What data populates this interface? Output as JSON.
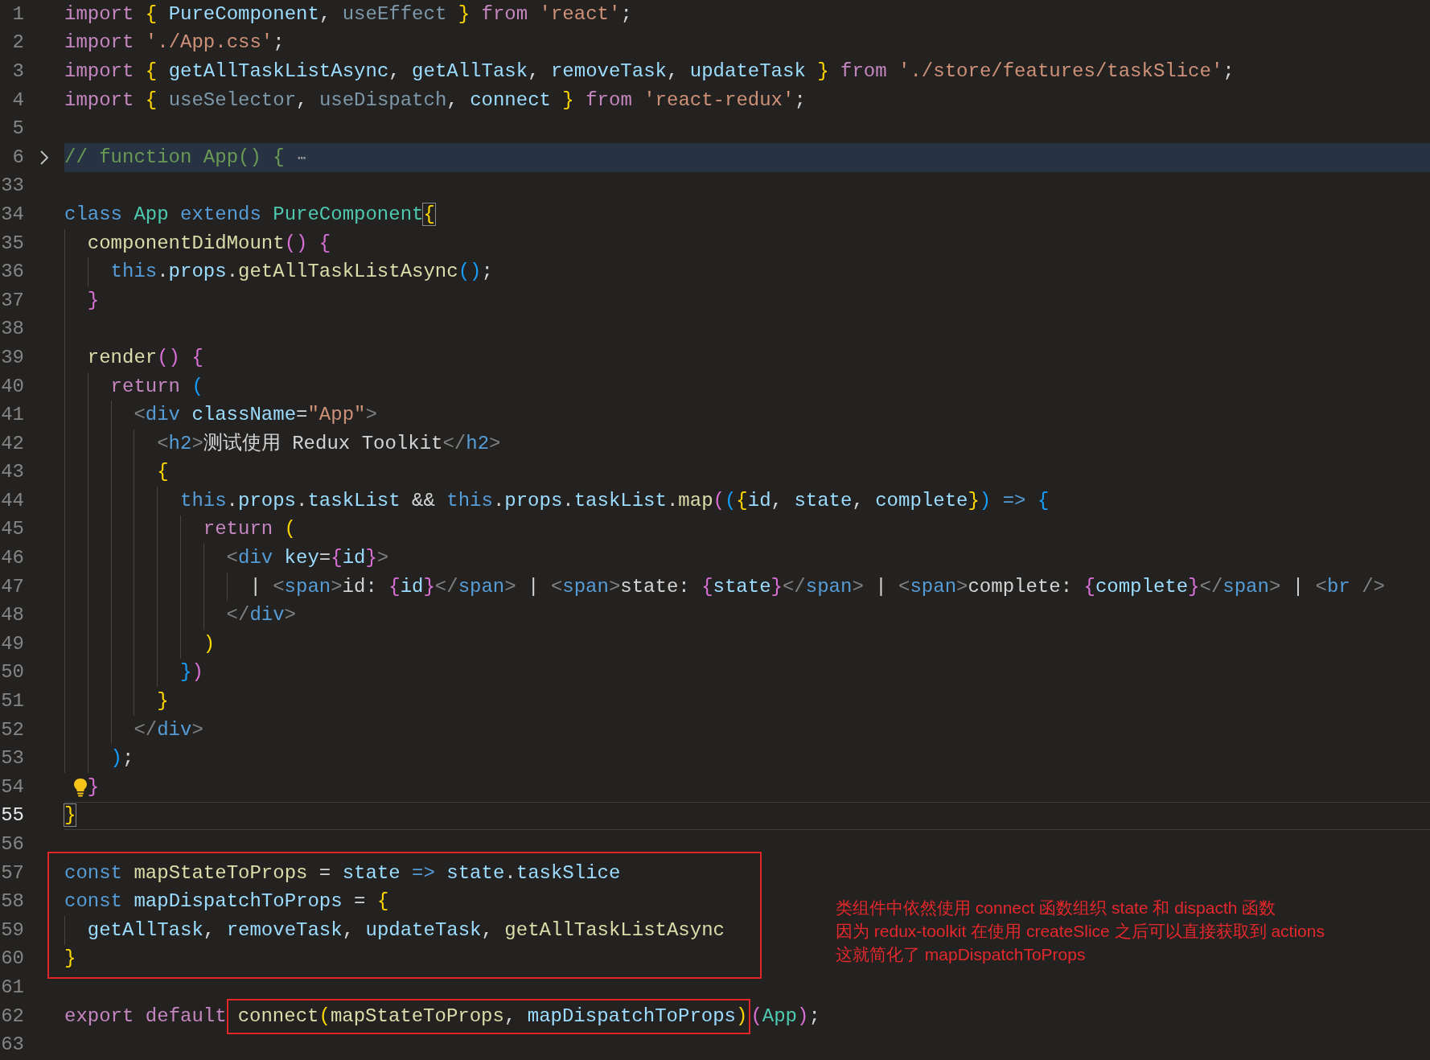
{
  "editor": {
    "lines": [
      {
        "number": "1",
        "tokens": [
          {
            "text": "import ",
            "kind": "k"
          },
          {
            "text": "{ ",
            "kind": "b1"
          },
          {
            "text": "PureComponent",
            "kind": "v"
          },
          {
            "text": ", ",
            "kind": "p"
          },
          {
            "text": "useEffect ",
            "kind": "vd"
          },
          {
            "text": "} ",
            "kind": "b1"
          },
          {
            "text": "from ",
            "kind": "k"
          },
          {
            "text": "'react'",
            "kind": "str"
          },
          {
            "text": ";",
            "kind": "p"
          }
        ]
      },
      {
        "number": "2",
        "tokens": [
          {
            "text": "import ",
            "kind": "k"
          },
          {
            "text": "'./App.css'",
            "kind": "str"
          },
          {
            "text": ";",
            "kind": "p"
          }
        ]
      },
      {
        "number": "3",
        "tokens": [
          {
            "text": "import ",
            "kind": "k"
          },
          {
            "text": "{ ",
            "kind": "b1"
          },
          {
            "text": "getAllTaskListAsync",
            "kind": "v"
          },
          {
            "text": ", ",
            "kind": "p"
          },
          {
            "text": "getAllTask",
            "kind": "v"
          },
          {
            "text": ", ",
            "kind": "p"
          },
          {
            "text": "removeTask",
            "kind": "v"
          },
          {
            "text": ", ",
            "kind": "p"
          },
          {
            "text": "updateTask ",
            "kind": "v"
          },
          {
            "text": "} ",
            "kind": "b1"
          },
          {
            "text": "from ",
            "kind": "k"
          },
          {
            "text": "'./store/features/taskSlice'",
            "kind": "str"
          },
          {
            "text": ";",
            "kind": "p"
          }
        ]
      },
      {
        "number": "4",
        "tokens": [
          {
            "text": "import ",
            "kind": "k"
          },
          {
            "text": "{ ",
            "kind": "b1"
          },
          {
            "text": "useSelector",
            "kind": "vd"
          },
          {
            "text": ", ",
            "kind": "p"
          },
          {
            "text": "useDispatch",
            "kind": "vd"
          },
          {
            "text": ", ",
            "kind": "p"
          },
          {
            "text": "connect ",
            "kind": "v"
          },
          {
            "text": "} ",
            "kind": "b1"
          },
          {
            "text": "from ",
            "kind": "k"
          },
          {
            "text": "'react-redux'",
            "kind": "str"
          },
          {
            "text": ";",
            "kind": "p"
          }
        ]
      },
      {
        "number": "5"
      },
      {
        "number": "6",
        "folded": true,
        "tokens": [
          {
            "text": "// function App() { ",
            "kind": "cm"
          },
          {
            "text": "⋯",
            "kind": "fold"
          }
        ]
      },
      {
        "number": "33"
      },
      {
        "number": "34",
        "tokens": [
          {
            "text": "class ",
            "kind": "s"
          },
          {
            "text": "App ",
            "kind": "c"
          },
          {
            "text": "extends ",
            "kind": "s"
          },
          {
            "text": "PureComponent",
            "kind": "c"
          },
          {
            "text": "{",
            "kind": "b1m"
          }
        ]
      },
      {
        "number": "35",
        "tokens": [
          {
            "text": "  componentDidMount",
            "kind": "f"
          },
          {
            "text": "() ",
            "kind": "b2"
          },
          {
            "text": "{",
            "kind": "b2"
          }
        ]
      },
      {
        "number": "36",
        "tokens": [
          {
            "text": "    this",
            "kind": "s"
          },
          {
            "text": ".",
            "kind": "p"
          },
          {
            "text": "props",
            "kind": "v"
          },
          {
            "text": ".",
            "kind": "p"
          },
          {
            "text": "getAllTaskListAsync",
            "kind": "f"
          },
          {
            "text": "()",
            "kind": "b3"
          },
          {
            "text": ";",
            "kind": "p"
          }
        ]
      },
      {
        "number": "37",
        "tokens": [
          {
            "text": "  }",
            "kind": "b2"
          }
        ]
      },
      {
        "number": "38"
      },
      {
        "number": "39",
        "tokens": [
          {
            "text": "  render",
            "kind": "f"
          },
          {
            "text": "() ",
            "kind": "b2"
          },
          {
            "text": "{",
            "kind": "b2"
          }
        ]
      },
      {
        "number": "40",
        "tokens": [
          {
            "text": "    return ",
            "kind": "k"
          },
          {
            "text": "(",
            "kind": "b3"
          }
        ]
      },
      {
        "number": "41",
        "tokens": [
          {
            "text": "      <",
            "kind": "tp"
          },
          {
            "text": "div ",
            "kind": "tn"
          },
          {
            "text": "className",
            "kind": "v"
          },
          {
            "text": "=",
            "kind": "p"
          },
          {
            "text": "\"App\"",
            "kind": "str"
          },
          {
            "text": ">",
            "kind": "tp"
          }
        ]
      },
      {
        "number": "42",
        "tokens": [
          {
            "text": "        <",
            "kind": "tp"
          },
          {
            "text": "h2",
            "kind": "tn"
          },
          {
            "text": ">",
            "kind": "tp"
          },
          {
            "text": "测试使用 Redux Toolkit",
            "kind": "p"
          },
          {
            "text": "</",
            "kind": "tp"
          },
          {
            "text": "h2",
            "kind": "tn"
          },
          {
            "text": ">",
            "kind": "tp"
          }
        ]
      },
      {
        "number": "43",
        "tokens": [
          {
            "text": "        {",
            "kind": "b1"
          }
        ]
      },
      {
        "number": "44",
        "tokens": [
          {
            "text": "          this",
            "kind": "s"
          },
          {
            "text": ".",
            "kind": "p"
          },
          {
            "text": "props",
            "kind": "v"
          },
          {
            "text": ".",
            "kind": "p"
          },
          {
            "text": "taskList ",
            "kind": "v"
          },
          {
            "text": "&& ",
            "kind": "p"
          },
          {
            "text": "this",
            "kind": "s"
          },
          {
            "text": ".",
            "kind": "p"
          },
          {
            "text": "props",
            "kind": "v"
          },
          {
            "text": ".",
            "kind": "p"
          },
          {
            "text": "taskList",
            "kind": "v"
          },
          {
            "text": ".",
            "kind": "p"
          },
          {
            "text": "map",
            "kind": "f"
          },
          {
            "text": "(",
            "kind": "b2"
          },
          {
            "text": "(",
            "kind": "b3"
          },
          {
            "text": "{",
            "kind": "b1"
          },
          {
            "text": "id",
            "kind": "v"
          },
          {
            "text": ", ",
            "kind": "p"
          },
          {
            "text": "state",
            "kind": "v"
          },
          {
            "text": ", ",
            "kind": "p"
          },
          {
            "text": "complete",
            "kind": "v"
          },
          {
            "text": "}",
            "kind": "b1"
          },
          {
            "text": ") ",
            "kind": "b3"
          },
          {
            "text": "=> ",
            "kind": "s"
          },
          {
            "text": "{",
            "kind": "b3"
          }
        ]
      },
      {
        "number": "45",
        "tokens": [
          {
            "text": "            return ",
            "kind": "k"
          },
          {
            "text": "(",
            "kind": "b1"
          }
        ]
      },
      {
        "number": "46",
        "tokens": [
          {
            "text": "              <",
            "kind": "tp"
          },
          {
            "text": "div ",
            "kind": "tn"
          },
          {
            "text": "key",
            "kind": "v"
          },
          {
            "text": "=",
            "kind": "p"
          },
          {
            "text": "{",
            "kind": "b2"
          },
          {
            "text": "id",
            "kind": "v"
          },
          {
            "text": "}",
            "kind": "b2"
          },
          {
            "text": ">",
            "kind": "tp"
          }
        ]
      },
      {
        "number": "47",
        "tokens": [
          {
            "text": "                | ",
            "kind": "p"
          },
          {
            "text": "<",
            "kind": "tp"
          },
          {
            "text": "span",
            "kind": "tn"
          },
          {
            "text": ">",
            "kind": "tp"
          },
          {
            "text": "id: ",
            "kind": "p"
          },
          {
            "text": "{",
            "kind": "b2"
          },
          {
            "text": "id",
            "kind": "v"
          },
          {
            "text": "}",
            "kind": "b2"
          },
          {
            "text": "</",
            "kind": "tp"
          },
          {
            "text": "span",
            "kind": "tn"
          },
          {
            "text": "> ",
            "kind": "tp"
          },
          {
            "text": "| ",
            "kind": "p"
          },
          {
            "text": "<",
            "kind": "tp"
          },
          {
            "text": "span",
            "kind": "tn"
          },
          {
            "text": ">",
            "kind": "tp"
          },
          {
            "text": "state: ",
            "kind": "p"
          },
          {
            "text": "{",
            "kind": "b2"
          },
          {
            "text": "state",
            "kind": "v"
          },
          {
            "text": "}",
            "kind": "b2"
          },
          {
            "text": "</",
            "kind": "tp"
          },
          {
            "text": "span",
            "kind": "tn"
          },
          {
            "text": "> ",
            "kind": "tp"
          },
          {
            "text": "| ",
            "kind": "p"
          },
          {
            "text": "<",
            "kind": "tp"
          },
          {
            "text": "span",
            "kind": "tn"
          },
          {
            "text": ">",
            "kind": "tp"
          },
          {
            "text": "complete: ",
            "kind": "p"
          },
          {
            "text": "{",
            "kind": "b2"
          },
          {
            "text": "complete",
            "kind": "v"
          },
          {
            "text": "}",
            "kind": "b2"
          },
          {
            "text": "</",
            "kind": "tp"
          },
          {
            "text": "span",
            "kind": "tn"
          },
          {
            "text": "> ",
            "kind": "tp"
          },
          {
            "text": "| ",
            "kind": "p"
          },
          {
            "text": "<",
            "kind": "tp"
          },
          {
            "text": "br ",
            "kind": "tn"
          },
          {
            "text": "/>",
            "kind": "tp"
          }
        ]
      },
      {
        "number": "48",
        "tokens": [
          {
            "text": "              </",
            "kind": "tp"
          },
          {
            "text": "div",
            "kind": "tn"
          },
          {
            "text": ">",
            "kind": "tp"
          }
        ]
      },
      {
        "number": "49",
        "tokens": [
          {
            "text": "            )",
            "kind": "b1"
          }
        ]
      },
      {
        "number": "50",
        "tokens": [
          {
            "text": "          }",
            "kind": "b3"
          },
          {
            "text": ")",
            "kind": "b2"
          }
        ]
      },
      {
        "number": "51",
        "tokens": [
          {
            "text": "        }",
            "kind": "b1"
          }
        ]
      },
      {
        "number": "52",
        "tokens": [
          {
            "text": "      </",
            "kind": "tp"
          },
          {
            "text": "div",
            "kind": "tn"
          },
          {
            "text": ">",
            "kind": "tp"
          }
        ]
      },
      {
        "number": "53",
        "tokens": [
          {
            "text": "    )",
            "kind": "b3"
          },
          {
            "text": ";",
            "kind": "p"
          }
        ]
      },
      {
        "number": "54",
        "lightbulb": true,
        "tokens": [
          {
            "text": "  }",
            "kind": "b2"
          }
        ]
      },
      {
        "number": "55",
        "current": true,
        "tokens": [
          {
            "text": "}",
            "kind": "b1m"
          }
        ]
      },
      {
        "number": "56"
      },
      {
        "number": "57",
        "boxed": true,
        "tokens": [
          {
            "text": "const ",
            "kind": "s"
          },
          {
            "text": "mapStateToProps ",
            "kind": "f"
          },
          {
            "text": "= ",
            "kind": "p"
          },
          {
            "text": "state ",
            "kind": "v"
          },
          {
            "text": "=> ",
            "kind": "s"
          },
          {
            "text": "state",
            "kind": "v"
          },
          {
            "text": ".",
            "kind": "p"
          },
          {
            "text": "taskSlice",
            "kind": "v"
          }
        ]
      },
      {
        "number": "58",
        "boxed": true,
        "tokens": [
          {
            "text": "const ",
            "kind": "s"
          },
          {
            "text": "mapDispatchToProps ",
            "kind": "v"
          },
          {
            "text": "= ",
            "kind": "p"
          },
          {
            "text": "{",
            "kind": "b1"
          }
        ]
      },
      {
        "number": "59",
        "boxed": true,
        "tokens": [
          {
            "text": "  getAllTask",
            "kind": "v"
          },
          {
            "text": ", ",
            "kind": "p"
          },
          {
            "text": "removeTask",
            "kind": "v"
          },
          {
            "text": ", ",
            "kind": "p"
          },
          {
            "text": "updateTask",
            "kind": "v"
          },
          {
            "text": ", ",
            "kind": "p"
          },
          {
            "text": "getAllTaskListAsync",
            "kind": "f"
          }
        ]
      },
      {
        "number": "60",
        "boxed": true,
        "tokens": [
          {
            "text": "}",
            "kind": "b1"
          }
        ]
      },
      {
        "number": "61"
      },
      {
        "number": "62",
        "tokens": [
          {
            "text": "export ",
            "kind": "k"
          },
          {
            "text": "default",
            "kind": "k"
          },
          {
            "kind": "frame",
            "tokens": [
              {
                "text": "connect",
                "kind": "f"
              },
              {
                "text": "(",
                "kind": "b1"
              },
              {
                "text": "mapStateToProps",
                "kind": "f"
              },
              {
                "text": ", ",
                "kind": "p"
              },
              {
                "text": "mapDispatchToProps",
                "kind": "v"
              },
              {
                "text": ")",
                "kind": "b1"
              }
            ]
          },
          {
            "text": "(",
            "kind": "b2"
          },
          {
            "text": "App",
            "kind": "c"
          },
          {
            "text": ")",
            "kind": "b2"
          },
          {
            "text": ";",
            "kind": "p"
          }
        ]
      },
      {
        "number": "63"
      }
    ]
  },
  "annotation": {
    "lines": [
      "类组件中依然使用 connect 函数组织 state 和 dispacth 函数",
      "因为 redux-toolkit 在使用 createSlice 之后可以直接获取到 actions",
      "这就简化了 mapDispatchToProps"
    ]
  }
}
